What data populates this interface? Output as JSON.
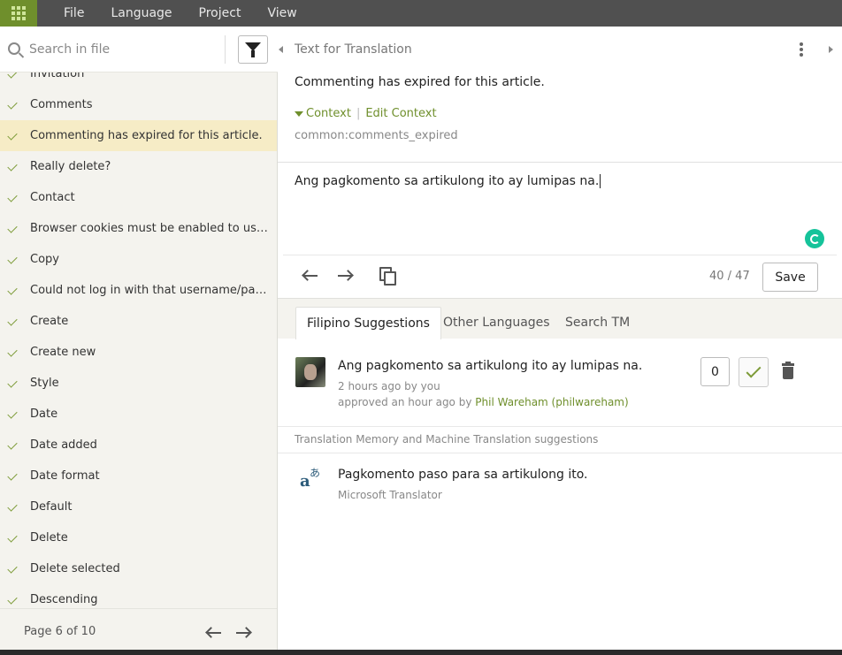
{
  "menu": {
    "items": [
      "File",
      "Language",
      "Project",
      "View"
    ]
  },
  "sidebar": {
    "search_placeholder": "Search in file",
    "strings": [
      "Invitation",
      "Comments",
      "Commenting has expired for this article.",
      "Really delete?",
      "Contact",
      "Browser cookies must be enabled to use T...",
      "Copy",
      "Could not log in with that username/pass...",
      "Create",
      "Create new",
      "Style",
      "Date",
      "Date added",
      "Date format",
      "Default",
      "Delete",
      "Delete selected",
      "Descending"
    ],
    "active_index": 2,
    "pager": {
      "text": "Page 6 of 10"
    }
  },
  "editor": {
    "source_title": "Text for Translation",
    "source_text": "Commenting has expired for this article.",
    "context_label": "Context",
    "edit_context_label": "Edit Context",
    "context_separator": "|",
    "context_key": "common:comments_expired",
    "translation_text": "Ang pagkomento sa artikulong ito ay lumipas na.",
    "counter": "40 / 47",
    "save_label": "Save"
  },
  "tabs": [
    {
      "label": "Filipino Suggestions",
      "active": true
    },
    {
      "label": "Other Languages",
      "active": false
    },
    {
      "label": "Search TM",
      "active": false
    }
  ],
  "suggestion": {
    "text": "Ang pagkomento sa artikulong ito ay lumipas na.",
    "meta_time": "2 hours ago by you",
    "approved_prefix": "approved an hour ago by",
    "approved_by": "Phil Wareham (philwareham)",
    "votes": "0"
  },
  "tm": {
    "header": "Translation Memory and Machine Translation suggestions",
    "text": "Pagkomento paso para sa artikulong ito.",
    "source": "Microsoft Translator"
  },
  "colors": {
    "menubar": "#505050",
    "accent_green": "#6f8f2c",
    "active_row": "#f6ecc6",
    "sidebar_bg": "#f4f3ee",
    "grammarly": "#15c39a"
  }
}
